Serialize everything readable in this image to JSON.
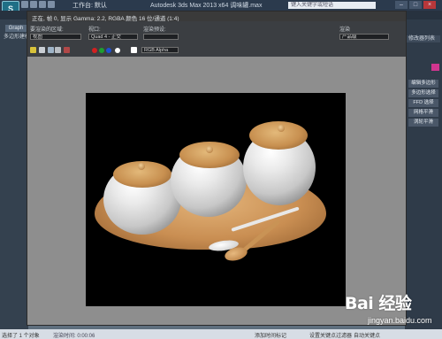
{
  "app": {
    "logo": "S",
    "workspace": "工作台: 默认",
    "title": "Autodesk 3ds Max 2013 x64    调味罐.max",
    "search_placeholder": "键入关键字或短语",
    "win_minimize": "–",
    "win_restore": "□",
    "win_close": "×"
  },
  "left_panel": {
    "graph_label": "Graph",
    "viewport_label": "多边形建模"
  },
  "render_frame": {
    "title": "正在, 帧 0, 显示 Gamma: 2.2, RGBA 颜色 16 位/通道 (1:4)",
    "area_label": "要渲染的区域:",
    "area_value": "视图",
    "viewport_label": "视口:",
    "viewport_value": "Quad 4 - 正交",
    "preset_label": "渲染预设:",
    "preset_value": "",
    "render_label": "渲染",
    "render_value": "产品级",
    "channel_value": "RGB Alpha",
    "toolbar_icons": [
      "save-icon",
      "copy-icon",
      "clone-icon",
      "print-icon",
      "clear-icon"
    ],
    "channel_dots": [
      "#d22020",
      "#1e9e30",
      "#2050d0",
      "#ffffff"
    ]
  },
  "right_panel": {
    "dropdown": "修改器列表",
    "swatch_color": "#d0358f",
    "buttons": [
      "编辑多边形",
      "多边形选择",
      "FFD 选择",
      "网格平滑",
      "涡轮平滑"
    ]
  },
  "status": {
    "left": "选择了 1 个对象",
    "mid": "渲染时间: 0:00:06",
    "r1": "添加时间标记",
    "r2": "设置关键点过滤器",
    "r3": "自动关键点"
  },
  "watermark": {
    "brand": "Bai 经验",
    "url": "jingyan.baidu.com"
  }
}
